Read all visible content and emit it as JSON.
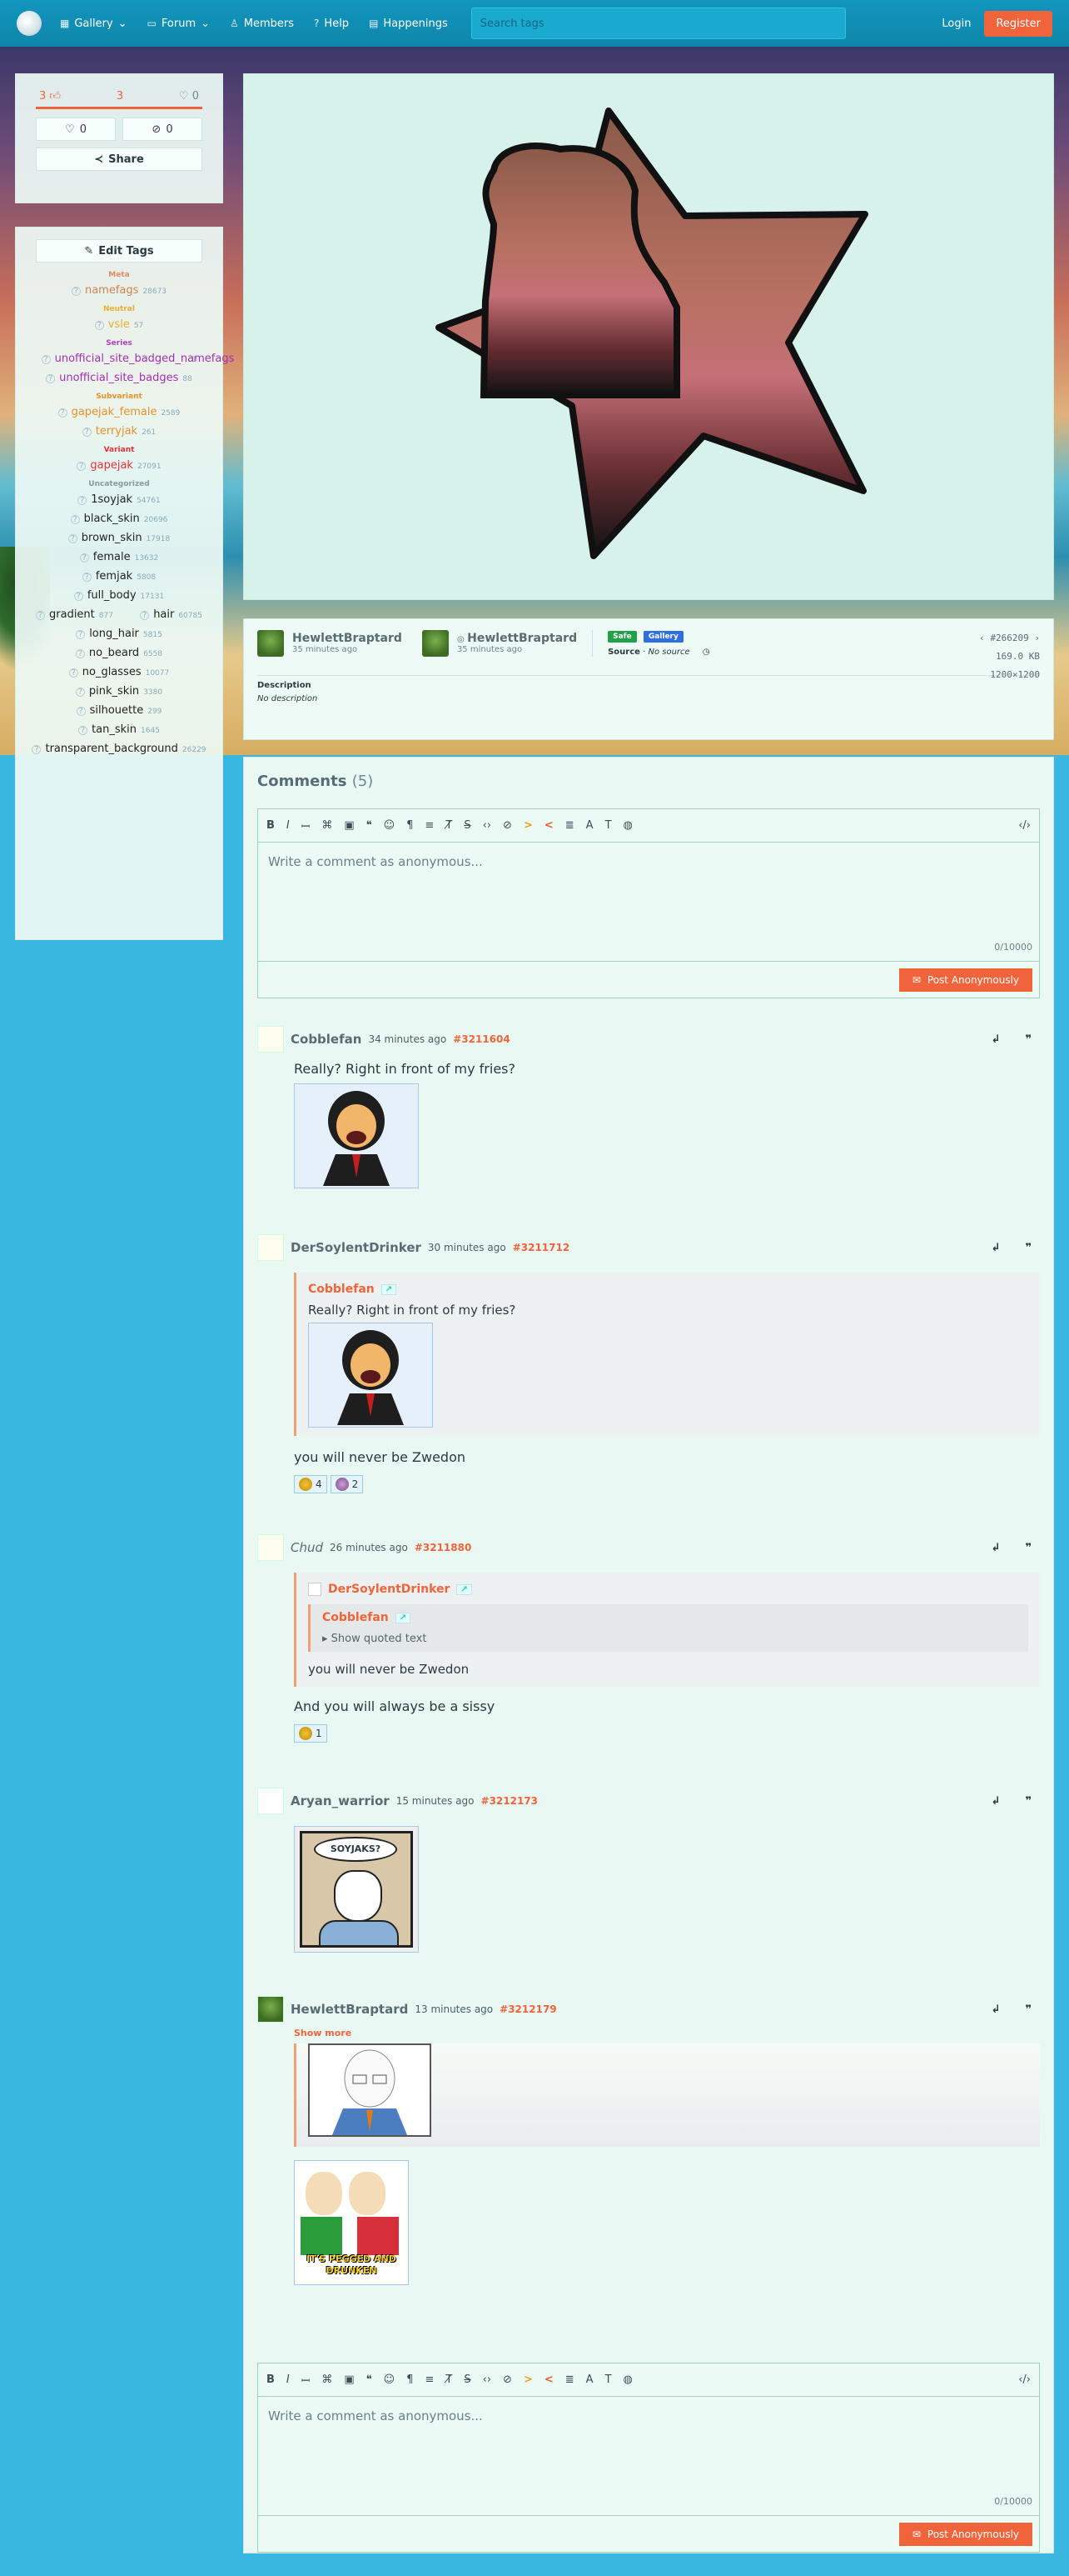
{
  "nav": {
    "items": [
      {
        "label": "Gallery",
        "icon": "gallery-icon"
      },
      {
        "label": "Forum",
        "icon": "forum-icon"
      },
      {
        "label": "Members",
        "icon": "members-icon"
      },
      {
        "label": "Help",
        "icon": "help-icon"
      },
      {
        "label": "Happenings",
        "icon": "happenings-icon"
      }
    ],
    "search_placeholder": "Search tags",
    "login": "Login",
    "register": "Register"
  },
  "votes": {
    "up": "3",
    "score": "3",
    "down": "0",
    "fave": "0",
    "hide": "0",
    "share": "Share"
  },
  "tags": {
    "edit": "Edit Tags",
    "categories": [
      {
        "name": "Meta",
        "color": "#e08b6a",
        "items": [
          {
            "name": "namefags",
            "count": "28673"
          }
        ]
      },
      {
        "name": "Neutral",
        "color": "#e8b030",
        "items": [
          {
            "name": "vsle",
            "count": "57"
          }
        ]
      },
      {
        "name": "Series",
        "color": "#b03fc0",
        "items": [
          {
            "name": "unofficial_site_badged_namefags",
            "count": "1"
          },
          {
            "name": "unofficial_site_badges",
            "count": "88"
          }
        ]
      },
      {
        "name": "Subvariant",
        "color": "#e8902a",
        "items": [
          {
            "name": "gapejak_female",
            "count": "2589"
          },
          {
            "name": "terryjak",
            "count": "261"
          }
        ]
      },
      {
        "name": "Variant",
        "color": "#e0323a",
        "items": [
          {
            "name": "gapejak",
            "count": "27091"
          }
        ]
      },
      {
        "name": "Uncategorized",
        "color": "#8a9aa2",
        "items": [
          {
            "name": "1soyjak",
            "count": "54761"
          },
          {
            "name": "black_skin",
            "count": "20696"
          },
          {
            "name": "brown_skin",
            "count": "17918"
          },
          {
            "name": "female",
            "count": "13632"
          },
          {
            "name": "femjak",
            "count": "5808"
          },
          {
            "name": "full_body",
            "count": "17131"
          },
          {
            "name": "gradient",
            "count": "877"
          },
          {
            "name": "hair",
            "count": "60785"
          },
          {
            "name": "long_hair",
            "count": "5815"
          },
          {
            "name": "no_beard",
            "count": "6558"
          },
          {
            "name": "no_glasses",
            "count": "10077"
          },
          {
            "name": "pink_skin",
            "count": "3380"
          },
          {
            "name": "silhouette",
            "count": "299"
          },
          {
            "name": "tan_skin",
            "count": "1645"
          },
          {
            "name": "transparent_background",
            "count": "26229"
          }
        ]
      }
    ]
  },
  "post": {
    "uploader": "HewlettBraptard",
    "uploader_time": "35 minutes ago",
    "approver": "HewlettBraptard",
    "approver_time": "35 minutes ago",
    "rating": "Safe",
    "rating_color": "#21a04a",
    "collection": "Gallery",
    "collection_color": "#2f6fe0",
    "source_label": "Source",
    "source_value": "No source",
    "id": "#266209",
    "size": "169.0 KB",
    "dims": "1200×1200",
    "desc_label": "Description",
    "desc_value": "No description"
  },
  "comments": {
    "title": "Comments",
    "count": "(5)",
    "placeholder": "Write a comment as anonymous...",
    "counter": "0/10000",
    "post_btn": "Post Anonymously",
    "list": [
      {
        "name": "Cobblefan",
        "time": "34 minutes ago",
        "id": "#3211604",
        "text": "Really? Right in front of my fries?"
      },
      {
        "name": "DerSoylentDrinker",
        "time": "30 minutes ago",
        "id": "#3211712",
        "quote_name": "Cobblefan",
        "quote_text": "Really? Right in front of my fries?",
        "text": "you will never be Zwedon",
        "reactions": [
          "4",
          "2"
        ]
      },
      {
        "name": "Chud",
        "time": "26 minutes ago",
        "id": "#3211880",
        "quote_name": "DerSoylentDrinker",
        "inner_quote_name": "Cobblefan",
        "show_quoted": "Show quoted text",
        "quote_text": "you will never be Zwedon",
        "text": "And you will always be a sissy",
        "reactions": [
          "1"
        ]
      },
      {
        "name": "Aryan_warrior",
        "time": "15 minutes ago",
        "id": "#3212173",
        "img_text": "SOYJAKS?"
      },
      {
        "name": "HewlettBraptard",
        "time": "13 minutes ago",
        "id": "#3212179",
        "show_more": "Show more",
        "img_text": "IT'S PEGGED AND DRUNKEN"
      }
    ]
  }
}
